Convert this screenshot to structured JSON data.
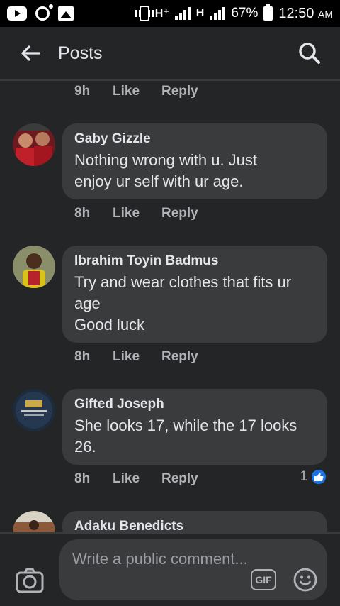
{
  "status_bar": {
    "network_1": "H⁺",
    "network_2": "H",
    "battery": "67%",
    "time": "12:50",
    "ampm": "AM"
  },
  "header": {
    "title": "Posts"
  },
  "top_meta": {
    "time": "9h",
    "like": "Like",
    "reply": "Reply"
  },
  "comments": [
    {
      "author": "Gaby Gizzle",
      "text": "Nothing wrong with u. Just\nenjoy ur self with ur age.",
      "time": "8h",
      "like": "Like",
      "reply": "Reply"
    },
    {
      "author": "Ibrahim Toyin Badmus",
      "text": "Try and wear clothes that fits ur\nage\nGood luck",
      "time": "8h",
      "like": "Like",
      "reply": "Reply"
    },
    {
      "author": "Gifted Joseph",
      "text": "She looks 17, while the 17 looks\n26.",
      "time": "8h",
      "like": "Like",
      "reply": "Reply",
      "reaction_count": "1"
    },
    {
      "author": "Adaku Benedicts"
    }
  ],
  "composer": {
    "placeholder": "Write a public comment...",
    "gif_label": "GIF"
  },
  "colors": {
    "background": "#242526",
    "bubble": "#3a3b3c",
    "accent": "#1b74e4"
  }
}
